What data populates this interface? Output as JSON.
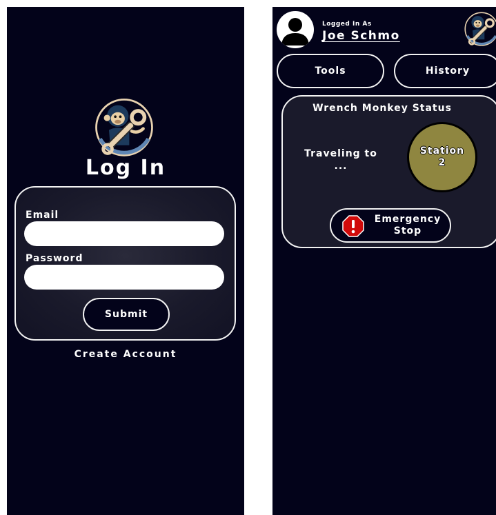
{
  "login": {
    "title": "Log In",
    "email_label": "Email",
    "email_value": "",
    "password_label": "Password",
    "password_value": "",
    "submit_label": "Submit",
    "create_account_label": "Create Account"
  },
  "status_screen": {
    "logged_in_label": "Logged In As",
    "user_name": "Joe Schmo",
    "nav": {
      "tools_label": "Tools",
      "history_label": "History"
    },
    "status_card": {
      "title": "Wrench Monkey Status",
      "travel_text": "Traveling to\n...",
      "station_text": "Station\n2",
      "station_color": "#8f8640"
    },
    "emergency_stop_label": "Emergency\nStop",
    "emergency_icon": "exclamation-octagon-icon",
    "emergency_color": "#d10a0a"
  },
  "logo_icon": "wrench-monkey-logo",
  "colors": {
    "background": "#03031a",
    "card": "#1a1a2b",
    "border": "#f2f2f2",
    "text": "#ffffff"
  }
}
